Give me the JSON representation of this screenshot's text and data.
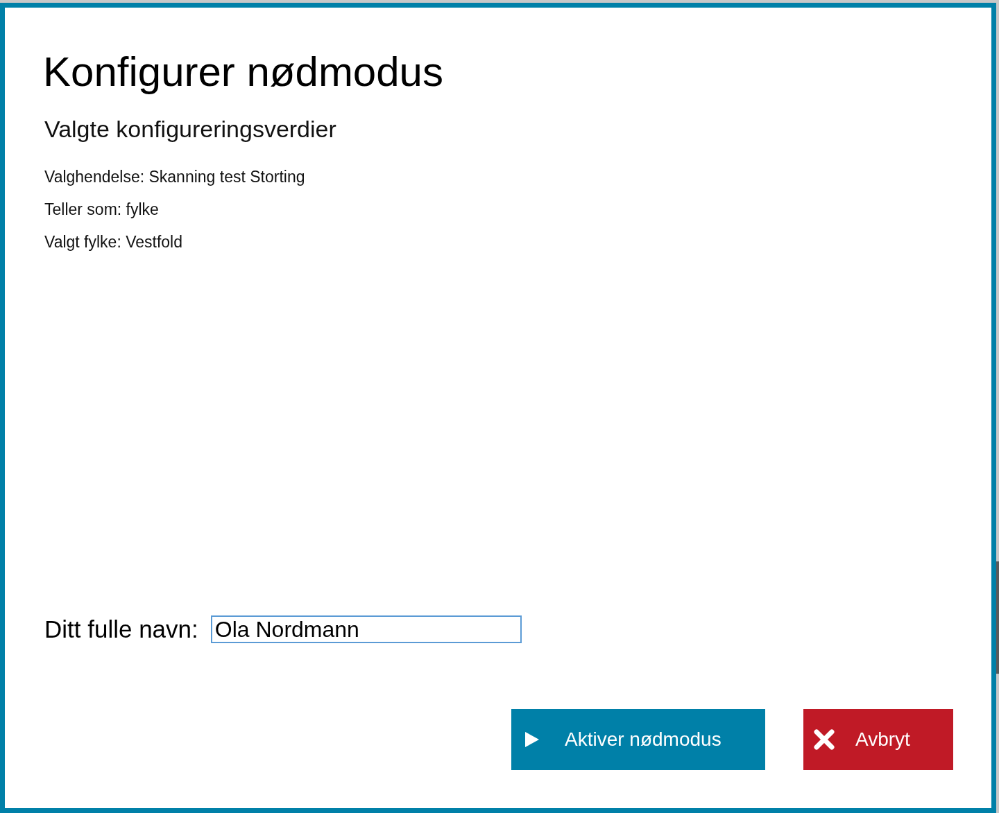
{
  "dialog": {
    "title": "Konfigurer nødmodus",
    "subtitle": "Valgte konfigureringsverdier",
    "values": [
      "Valghendelse: Skanning test Storting",
      "Teller som: fylke",
      "Valgt fylke: Vestfold"
    ],
    "name_field": {
      "label": "Ditt fulle navn:",
      "value": "Ola Nordmann"
    },
    "buttons": [
      {
        "kind": "confirm",
        "label": "Aktiver nødmodus"
      },
      {
        "kind": "cancel",
        "label": "Avbryt"
      }
    ]
  }
}
